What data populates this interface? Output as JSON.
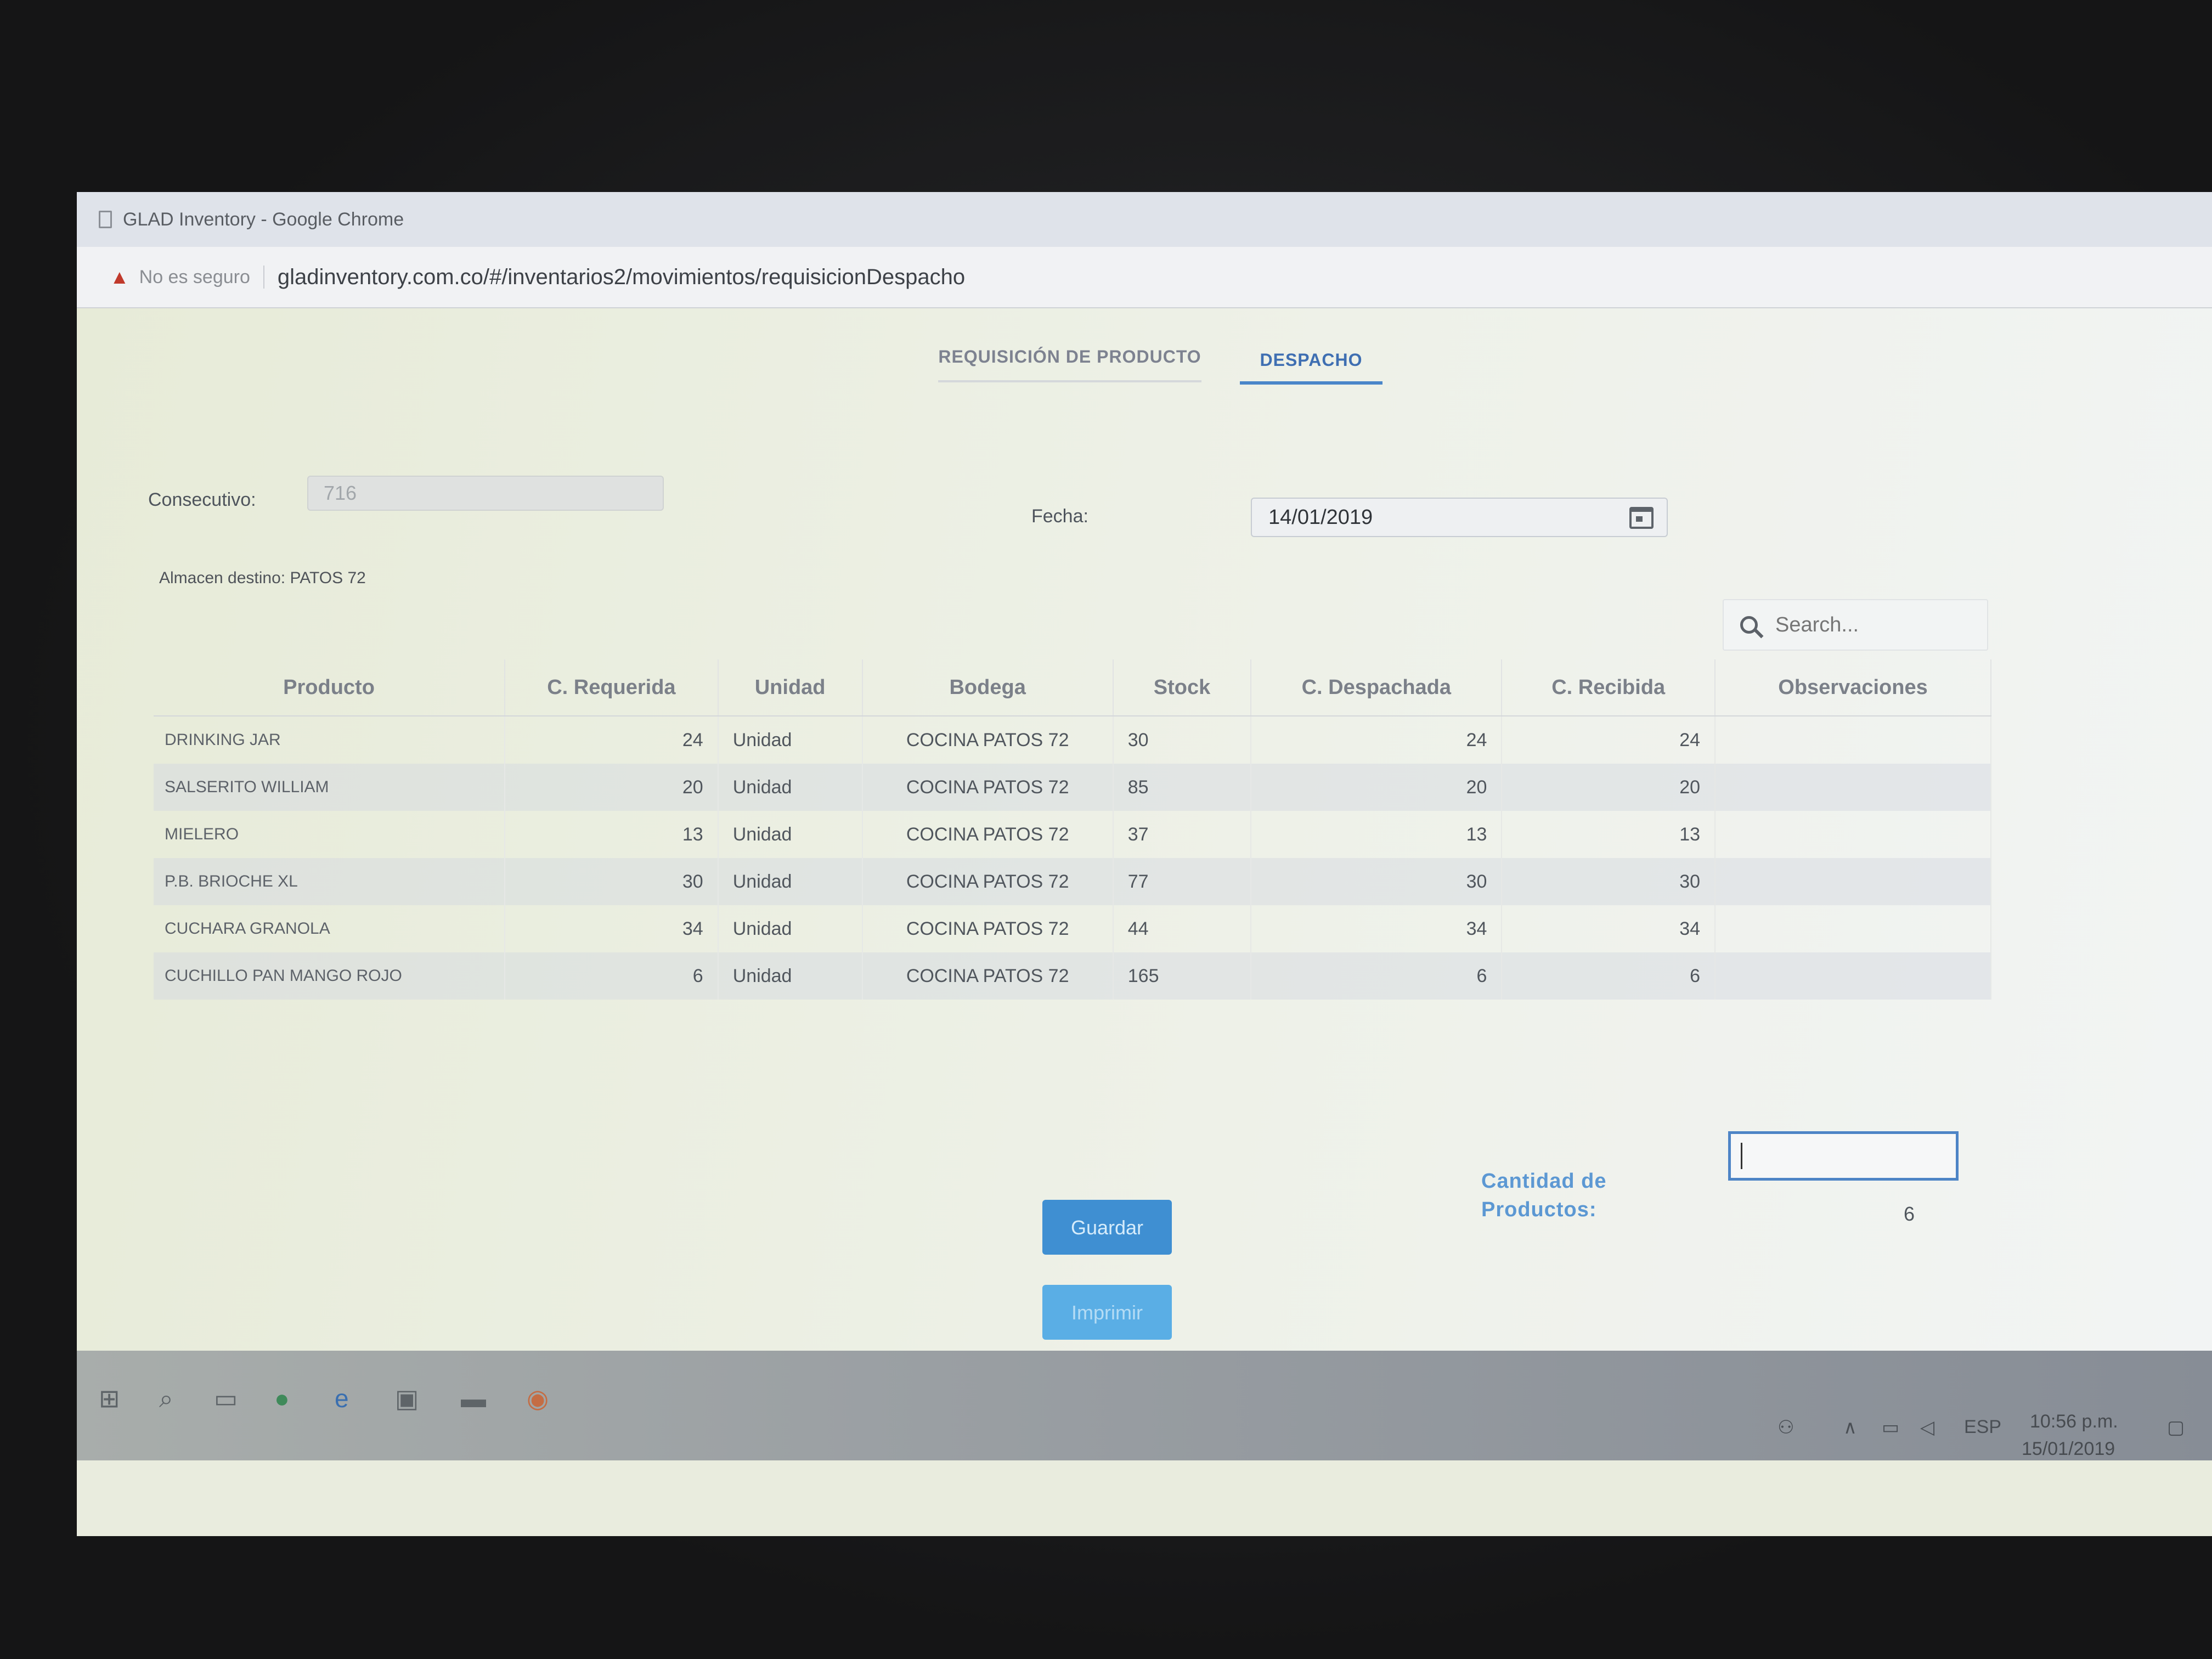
{
  "window": {
    "title": "GLAD Inventory - Google Chrome"
  },
  "address_bar": {
    "security_label": "No es seguro",
    "url": "gladinventory.com.co/#/inventarios2/movimientos/requisicionDespacho"
  },
  "tabs": [
    {
      "label": "REQUISICIÓN DE PRODUCTO",
      "active": false
    },
    {
      "label": "DESPACHO",
      "active": true
    }
  ],
  "form": {
    "consecutivo_label": "Consecutivo:",
    "consecutivo_value": "716",
    "fecha_label": "Fecha:",
    "fecha_value": "14/01/2019",
    "almacen_destino": "Almacen destino: PATOS 72"
  },
  "search": {
    "placeholder": "Search..."
  },
  "table": {
    "headers": [
      "Producto",
      "C. Requerida",
      "Unidad",
      "Bodega",
      "Stock",
      "C. Despachada",
      "C. Recibida",
      "Observaciones"
    ],
    "rows": [
      {
        "producto": "DRINKING JAR",
        "requerida": "24",
        "unidad": "Unidad",
        "bodega": "COCINA PATOS 72",
        "stock": "30",
        "despachada": "24",
        "recibida": "24",
        "observaciones": ""
      },
      {
        "producto": "SALSERITO WILLIAM",
        "requerida": "20",
        "unidad": "Unidad",
        "bodega": "COCINA PATOS 72",
        "stock": "85",
        "despachada": "20",
        "recibida": "20",
        "observaciones": ""
      },
      {
        "producto": "MIELERO",
        "requerida": "13",
        "unidad": "Unidad",
        "bodega": "COCINA PATOS 72",
        "stock": "37",
        "despachada": "13",
        "recibida": "13",
        "observaciones": ""
      },
      {
        "producto": "P.B. BRIOCHE XL",
        "requerida": "30",
        "unidad": "Unidad",
        "bodega": "COCINA PATOS 72",
        "stock": "77",
        "despachada": "30",
        "recibida": "30",
        "observaciones": ""
      },
      {
        "producto": "CUCHARA GRANOLA",
        "requerida": "34",
        "unidad": "Unidad",
        "bodega": "COCINA PATOS 72",
        "stock": "44",
        "despachada": "34",
        "recibida": "34",
        "observaciones": ""
      },
      {
        "producto": "CUCHILLO PAN MANGO ROJO",
        "requerida": "6",
        "unidad": "Unidad",
        "bodega": "COCINA PATOS 72",
        "stock": "165",
        "despachada": "6",
        "recibida": "6",
        "observaciones": ""
      }
    ]
  },
  "summary": {
    "label": "Cantidad de Productos:",
    "value": "6"
  },
  "buttons": {
    "guardar": "Guardar",
    "imprimir": "Imprimir"
  },
  "taskbar": {
    "language": "ESP",
    "time": "10:56 p.m.",
    "date": "15/01/2019"
  },
  "colors": {
    "accent": "#4a86c9",
    "button": "#4e9fdd",
    "warning": "#c0392b"
  }
}
